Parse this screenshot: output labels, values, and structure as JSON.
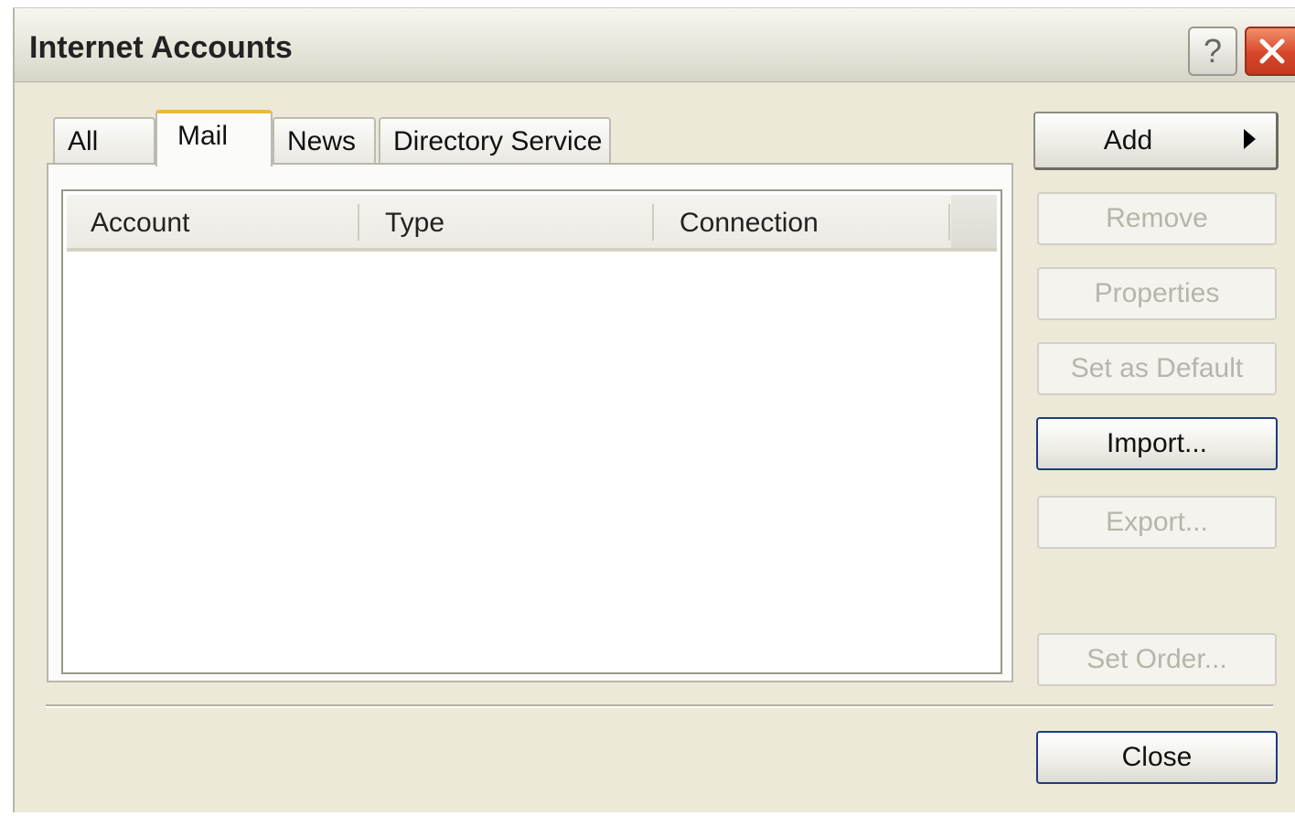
{
  "window": {
    "title": "Internet Accounts",
    "help_label": "?",
    "close_icon": "close-x-icon"
  },
  "tabs": [
    {
      "label": "All",
      "active": false
    },
    {
      "label": "Mail",
      "active": true
    },
    {
      "label": "News",
      "active": false
    },
    {
      "label": "Directory Service",
      "active": false
    }
  ],
  "list": {
    "columns": [
      "Account",
      "Type",
      "Connection"
    ],
    "rows": []
  },
  "buttons": {
    "add": {
      "label": "Add",
      "enabled": true
    },
    "remove": {
      "label": "Remove",
      "enabled": false
    },
    "properties": {
      "label": "Properties",
      "enabled": false
    },
    "set_default": {
      "label": "Set as Default",
      "enabled": false
    },
    "import": {
      "label": "Import...",
      "enabled": true
    },
    "export": {
      "label": "Export...",
      "enabled": false
    },
    "set_order": {
      "label": "Set Order...",
      "enabled": false
    },
    "close": {
      "label": "Close",
      "enabled": true
    }
  },
  "colors": {
    "dialog_bg": "#ece9d8",
    "active_tab_accent": "#f0b83e",
    "close_button": "#d7462a",
    "default_button_border": "#1c3d7c"
  }
}
